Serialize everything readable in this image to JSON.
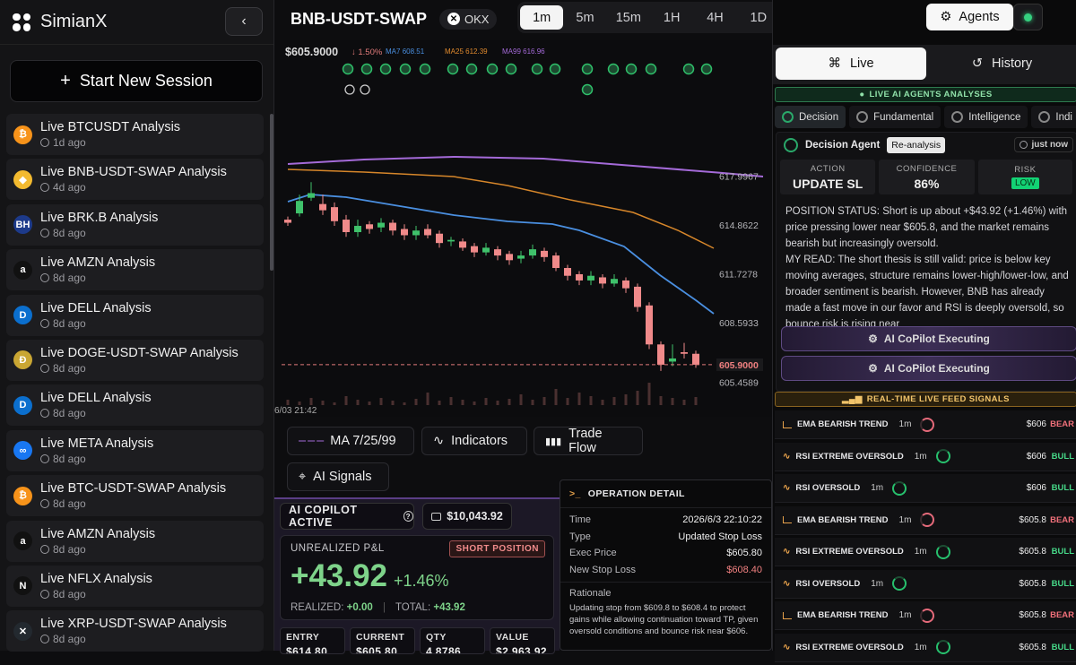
{
  "brand": {
    "name": "SimianX"
  },
  "sidebar": {
    "collapse_icon": "chevron-left-icon",
    "new_session": "Start New Session",
    "sessions": [
      {
        "title": "Live BTCUSDT Analysis",
        "time": "1d ago",
        "icon": "bitcoin-icon",
        "color": "#f7931a",
        "glyph": "₿"
      },
      {
        "title": "Live BNB-USDT-SWAP Analysis",
        "time": "4d ago",
        "icon": "bnb-icon",
        "color": "#f3ba2f",
        "glyph": "◆"
      },
      {
        "title": "Live BRK.B Analysis",
        "time": "8d ago",
        "icon": "berkshire-icon",
        "color": "#1d3a8a",
        "glyph": "BH"
      },
      {
        "title": "Live AMZN Analysis",
        "time": "8d ago",
        "icon": "amazon-icon",
        "color": "#111111",
        "glyph": "a"
      },
      {
        "title": "Live DELL Analysis",
        "time": "8d ago",
        "icon": "dell-icon",
        "color": "#0b6fce",
        "glyph": "D"
      },
      {
        "title": "Live DOGE-USDT-SWAP Analysis",
        "time": "8d ago",
        "icon": "doge-icon",
        "color": "#c9a633",
        "glyph": "Ð"
      },
      {
        "title": "Live DELL Analysis",
        "time": "8d ago",
        "icon": "dell-icon",
        "color": "#0b6fce",
        "glyph": "D"
      },
      {
        "title": "Live META Analysis",
        "time": "8d ago",
        "icon": "meta-icon",
        "color": "#1877f2",
        "glyph": "∞"
      },
      {
        "title": "Live BTC-USDT-SWAP Analysis",
        "time": "8d ago",
        "icon": "bitcoin-icon",
        "color": "#f7931a",
        "glyph": "₿"
      },
      {
        "title": "Live AMZN Analysis",
        "time": "8d ago",
        "icon": "amazon-icon",
        "color": "#111111",
        "glyph": "a"
      },
      {
        "title": "Live NFLX Analysis",
        "time": "8d ago",
        "icon": "netflix-icon",
        "color": "#111111",
        "glyph": "N"
      },
      {
        "title": "Live XRP-USDT-SWAP Analysis",
        "time": "8d ago",
        "icon": "xrp-icon",
        "color": "#23292f",
        "glyph": "✕"
      }
    ]
  },
  "header": {
    "symbol": "BNB-USDT-SWAP",
    "exchange": "OKX",
    "timeframes": [
      "1m",
      "5m",
      "15m",
      "1H",
      "4H",
      "1D"
    ],
    "active_timeframe": "1m"
  },
  "chart_data": {
    "type": "candlestick",
    "current_price": "$605.9000",
    "change": "↓ 1.50%",
    "legend": [
      {
        "name": "MA7",
        "value": "608.51",
        "color": "#4a8fe0"
      },
      {
        "name": "MA25",
        "value": "612.39",
        "color": "#e08a2e"
      },
      {
        "name": "MA99",
        "value": "616.96",
        "color": "#a46ad8"
      }
    ],
    "y_ticks": [
      "617.9967",
      "614.8622",
      "611.7278",
      "608.5933",
      "605.9000",
      "605.4589"
    ],
    "x_label": "6/03 21:42",
    "ylim": [
      604.0,
      619.8
    ]
  },
  "controls": {
    "ma": "MA 7/25/99",
    "indicators": "Indicators",
    "trade_flow": "Trade Flow",
    "ai_signals": "AI Signals"
  },
  "copilot": {
    "title": "AI COPILOT ACTIVE",
    "balance": "$10,043.92",
    "pnl_label": "UNREALIZED P&L",
    "position": "SHORT POSITION",
    "pnl": "+43.92",
    "pnl_pct": "+1.46%",
    "realized_label": "REALIZED:",
    "realized": "+0.00",
    "total_label": "TOTAL:",
    "total": "+43.92",
    "stats": [
      {
        "label": "ENTRY",
        "value": "$614.80"
      },
      {
        "label": "CURRENT",
        "value": "$605.80"
      },
      {
        "label": "QTY",
        "value": "4.8786"
      },
      {
        "label": "VALUE",
        "value": "$2,963.92"
      }
    ]
  },
  "operation": {
    "title": "OPERATION DETAIL",
    "rows": [
      {
        "k": "Time",
        "v": "2026/6/3 22:10:22",
        "red": false
      },
      {
        "k": "Type",
        "v": "Updated Stop Loss",
        "red": false
      },
      {
        "k": "Exec Price",
        "v": "$605.80",
        "red": false
      },
      {
        "k": "New Stop Loss",
        "v": "$608.40",
        "red": true
      }
    ],
    "rationale_label": "Rationale",
    "rationale": "Updating stop from $609.8 to $608.4 to protect gains while allowing continuation toward TP, given oversold conditions and bounce risk near $606."
  },
  "right": {
    "agents": "Agents",
    "tabs": [
      "Live",
      "History"
    ],
    "live_section": "LIVE AI AGENTS ANALYSES",
    "agent_tabs": [
      "Decision",
      "Fundamental",
      "Intelligence",
      "Indi"
    ],
    "decision": {
      "agent": "Decision Agent",
      "reanalysis": "Re-analysis",
      "time": "just now",
      "action_label": "ACTION",
      "action": "UPDATE SL",
      "confidence_label": "CONFIDENCE",
      "confidence": "86%",
      "risk_label": "RISK",
      "risk": "LOW",
      "p1": "POSITION STATUS: Short is up about +$43.92 (+1.46%) with price pressing lower near $605.8, and the market remains bearish but increasingly oversold.",
      "p2": "MY READ: The short thesis is still valid: price is below key moving averages, structure remains lower-high/lower-low, and broader sentiment is bearish. However, BNB has already made a fast move in our favor and RSI is deeply oversold, so bounce risk is rising near"
    },
    "exec": "AI CoPilot Executing",
    "feed_section": "REAL-TIME LIVE FEED SIGNALS",
    "signals": [
      {
        "name": "EMA BEARISH TREND",
        "tf": "1m",
        "price": "$606",
        "dir": "BEAR"
      },
      {
        "name": "RSI EXTREME OVERSOLD",
        "tf": "1m",
        "price": "$606",
        "dir": "BULL"
      },
      {
        "name": "RSI OVERSOLD",
        "tf": "1m",
        "price": "$606",
        "dir": "BULL"
      },
      {
        "name": "EMA BEARISH TREND",
        "tf": "1m",
        "price": "$605.8",
        "dir": "BEAR"
      },
      {
        "name": "RSI EXTREME OVERSOLD",
        "tf": "1m",
        "price": "$605.8",
        "dir": "BULL"
      },
      {
        "name": "RSI OVERSOLD",
        "tf": "1m",
        "price": "$605.8",
        "dir": "BULL"
      },
      {
        "name": "EMA BEARISH TREND",
        "tf": "1m",
        "price": "$605.8",
        "dir": "BEAR"
      },
      {
        "name": "RSI EXTREME OVERSOLD",
        "tf": "1m",
        "price": "$605.8",
        "dir": "BULL"
      }
    ]
  }
}
